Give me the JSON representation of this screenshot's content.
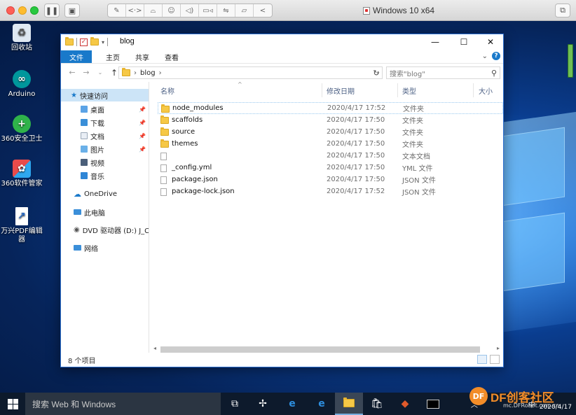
{
  "mac_window": {
    "title": "Windows 10 x64"
  },
  "desktop": {
    "icons": [
      {
        "label": "回收站"
      },
      {
        "label": "Arduino"
      },
      {
        "label": "360安全卫士"
      },
      {
        "label": "360软件管家"
      },
      {
        "label": "万兴PDF编辑器"
      }
    ]
  },
  "explorer": {
    "title": "blog",
    "ribbon": {
      "file_tab": "文件",
      "tabs": [
        "主页",
        "共享",
        "查看"
      ],
      "help": "?"
    },
    "address": {
      "path": "blog",
      "search_placeholder": "搜索\"blog\""
    },
    "nav": {
      "quick_access": "快速访问",
      "quick_items": [
        "桌面",
        "下载",
        "文档",
        "图片",
        "视频",
        "音乐"
      ],
      "onedrive": "OneDrive",
      "this_pc": "此电脑",
      "dvd": "DVD 驱动器 (D:) J_CC",
      "network": "网络"
    },
    "columns": {
      "name": "名称",
      "date": "修改日期",
      "type": "类型",
      "size": "大小"
    },
    "files": [
      {
        "name": "node_modules",
        "date": "2020/4/17 17:52",
        "type": "文件夹",
        "icon": "folder-icon"
      },
      {
        "name": "scaffolds",
        "date": "2020/4/17 17:50",
        "type": "文件夹",
        "icon": "folder-icon"
      },
      {
        "name": "source",
        "date": "2020/4/17 17:50",
        "type": "文件夹",
        "icon": "folder-icon"
      },
      {
        "name": "themes",
        "date": "2020/4/17 17:50",
        "type": "文件夹",
        "icon": "folder-icon"
      },
      {
        "name": "",
        "date": "2020/4/17 17:50",
        "type": "文本文档",
        "icon": "file-icon"
      },
      {
        "name": "_config.yml",
        "date": "2020/4/17 17:50",
        "type": "YML 文件",
        "icon": "file-icon"
      },
      {
        "name": "package.json",
        "date": "2020/4/17 17:50",
        "type": "JSON 文件",
        "icon": "file-icon"
      },
      {
        "name": "package-lock.json",
        "date": "2020/4/17 17:52",
        "type": "JSON 文件",
        "icon": "file-icon"
      }
    ],
    "status": "8 个项目"
  },
  "taskbar": {
    "search_placeholder": "搜索 Web 和 Windows",
    "tray_lang": "中",
    "tray_date": "2020/4/17"
  },
  "watermark": {
    "brand": "DF创客社区",
    "logo": "DF",
    "sub": "mc.DFRobot.com.cn"
  },
  "colors": {
    "accent": "#1979ca",
    "folder": "#f6c846",
    "taskbar": "#0d1a2c"
  }
}
